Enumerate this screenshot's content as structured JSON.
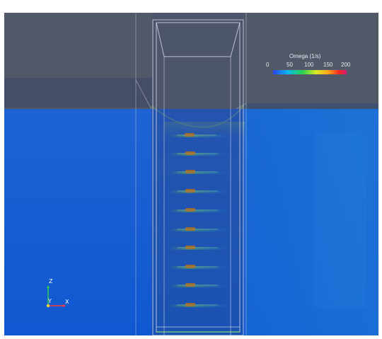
{
  "colorbar": {
    "title": "Omega (1/s)",
    "ticks": [
      "0",
      "50",
      "100",
      "150",
      "200"
    ],
    "colors": {
      "low": "#2a42f3",
      "mid_low": "#0bb6ef",
      "mid": "#27d34f",
      "mid_high": "#d9ea26",
      "high": "#ff9f18",
      "max": "#d1176d"
    }
  },
  "axes": {
    "x_label": "X",
    "y_label": "Y",
    "z_label": "Z"
  },
  "scene": {
    "background": "#515867",
    "water_color": "#1561d6",
    "frame_color": "#d8dce4",
    "fish_color": "#9b6a2f",
    "wake_color": "#61c64b"
  }
}
